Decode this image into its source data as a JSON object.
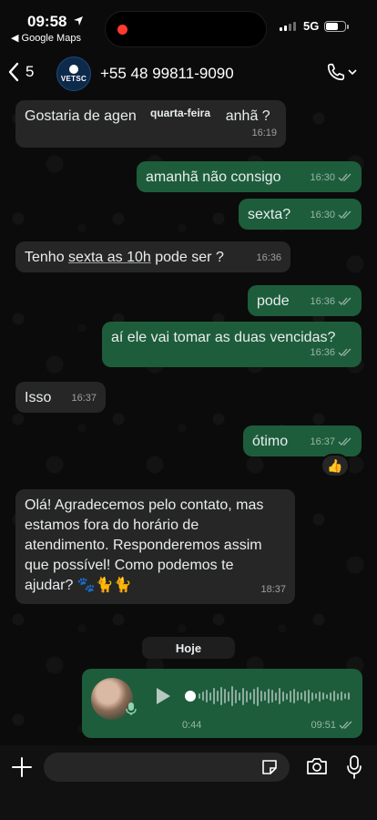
{
  "status_bar": {
    "time": "09:58",
    "back_app": "◀ Google Maps",
    "network": "5G",
    "battery_level": 0.65
  },
  "header": {
    "back_count": "5",
    "contact": "+55 48 99811-9090",
    "avatar_text": "VETSC"
  },
  "sticky_date": "quarta-feira",
  "messages": [
    {
      "direction": "in",
      "text_before": "Gostaria de agen",
      "text_after": "anhã ?",
      "time": "16:19"
    },
    {
      "direction": "out",
      "text": "amanhã não consigo",
      "time": "16:30"
    },
    {
      "direction": "out",
      "text": "sexta?",
      "time": "16:30"
    },
    {
      "direction": "in",
      "text_prefix": "Tenho ",
      "text_link": "sexta as 10h",
      "text_suffix": " pode ser ?",
      "time": "16:36"
    },
    {
      "direction": "out",
      "text": "pode",
      "time": "16:36"
    },
    {
      "direction": "out",
      "text": "aí ele vai tomar as duas vencidas?",
      "time": "16:36"
    },
    {
      "direction": "in",
      "text": "Isso",
      "time": "16:37"
    },
    {
      "direction": "out",
      "text": "ótimo",
      "time": "16:37",
      "reaction": "👍"
    },
    {
      "direction": "in",
      "text": "Olá! Agradecemos pelo contato, mas estamos fora do horário de atendimento. Responderemos assim que possível! Como podemos te ajudar? 🐾🐈🐈",
      "time": "18:37"
    }
  ],
  "day_chip": "Hoje",
  "voice_message": {
    "duration": "0:44",
    "time": "09:51",
    "progress": 0
  },
  "composer": {
    "placeholder": ""
  },
  "colors": {
    "incoming_bubble": "#262626",
    "outgoing_bubble": "#1d5d3b",
    "background": "#0b0b0b"
  }
}
